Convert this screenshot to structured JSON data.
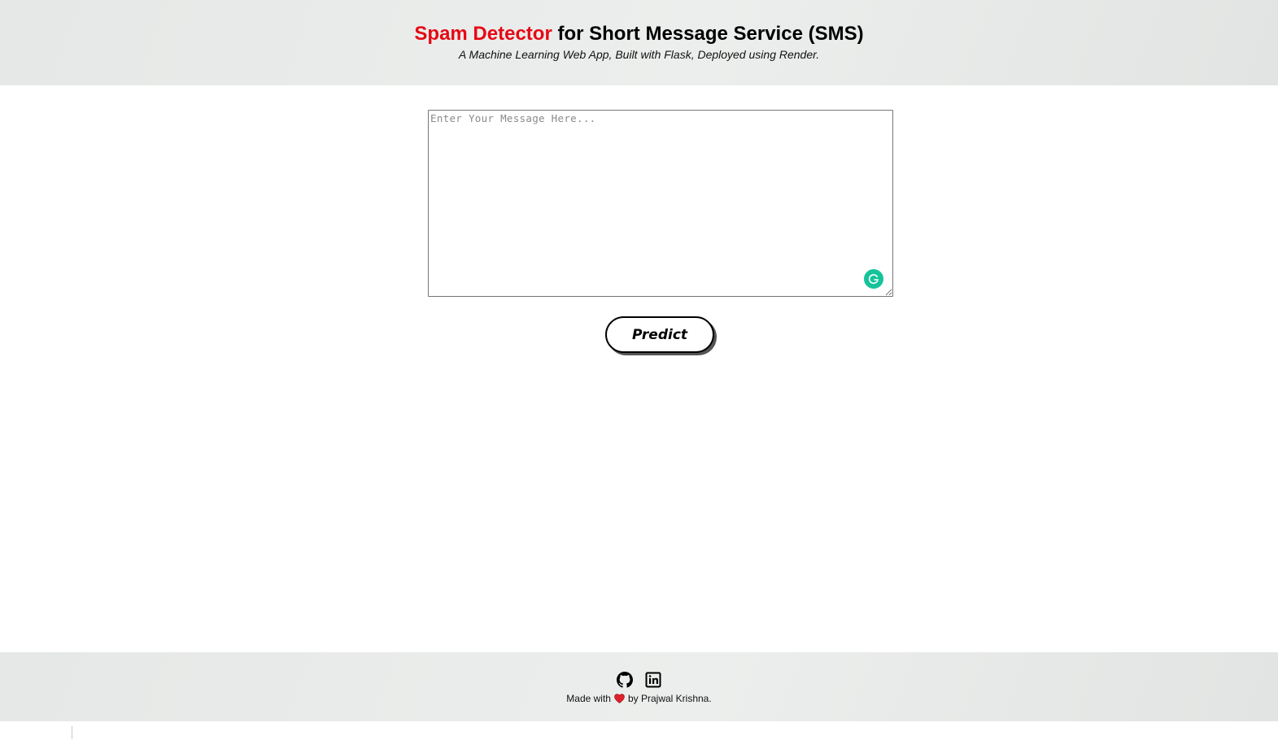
{
  "header": {
    "title_accent": "Spam Detector",
    "title_rest": " for Short Message Service (SMS)",
    "subtitle": "A Machine Learning Web App, Built with Flask, Deployed using Render."
  },
  "form": {
    "message_placeholder": "Enter Your Message Here...",
    "message_value": "",
    "predict_label": "Predict"
  },
  "footer": {
    "made_with": "Made with",
    "by_text": "by Prajwal Krishna.",
    "links": [
      {
        "icon": "github-icon"
      },
      {
        "icon": "linkedin-icon"
      }
    ]
  },
  "colors": {
    "accent": "#e50914",
    "grammarly": "#15c39a",
    "heart": "#e0202a"
  }
}
